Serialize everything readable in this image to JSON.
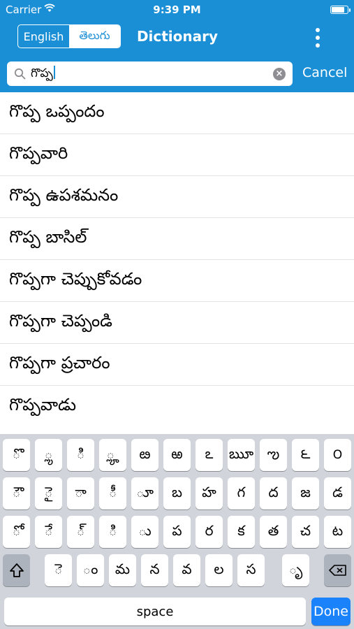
{
  "status_bar": {
    "carrier": "Carrier",
    "time": "9:39 PM",
    "battery_level": 0.9
  },
  "nav": {
    "segments": [
      "English",
      "తెలుగు"
    ],
    "selected_segment": "English",
    "title": "Dictionary",
    "menu_icon": "more-vertical-icon"
  },
  "search": {
    "query": "గొప్ప",
    "clear_icon": "clear-icon",
    "search_icon": "search-icon",
    "cancel_label": "Cancel"
  },
  "results": [
    "గొప్ప ఒప్పందం",
    "గొప్పవారి",
    "గొప్ప ఉపశమనం",
    "గొప్ప బాసిల్",
    "గొప్పగా చెప్పుకోవడం",
    "గొప్పగా చెప్పండి",
    "గొప్పగా ప్రచారం",
    "గొప్పవాడు"
  ],
  "keyboard": {
    "row1": [
      "ొ",
      "ా",
      "ి",
      "ీ",
      "ు",
      "ూ",
      "ృ",
      "ె",
      "ే",
      "ై",
      "ొ"
    ],
    "row1_display": [
      "ొ",
      "ౢ",
      "ి",
      "ౣ",
      "ఴ",
      "ఱ",
      "ఽ",
      "ౠ",
      "ఌ",
      "౬",
      "౦"
    ],
    "row2": [
      "ౌ",
      "ై",
      "ా",
      "ీ",
      "ూ",
      "బ",
      "హ",
      "గ",
      "ద",
      "జ",
      "డ"
    ],
    "row3": [
      "ో",
      "ే",
      "్",
      "ి",
      "ు",
      "ప",
      "ర",
      "క",
      "త",
      "చ",
      "ట"
    ],
    "row4": [
      "ె",
      "ం",
      "మ",
      "న",
      "వ",
      "ల",
      "స",
      "ృ"
    ],
    "shift_icon": "shift-icon",
    "delete_icon": "delete-icon",
    "space_label": "space",
    "done_label": "Done"
  },
  "colors": {
    "nav_blue": "#1b8fd6",
    "keyboard_bg": "#d1d5db",
    "done_blue": "#1a82fb"
  }
}
